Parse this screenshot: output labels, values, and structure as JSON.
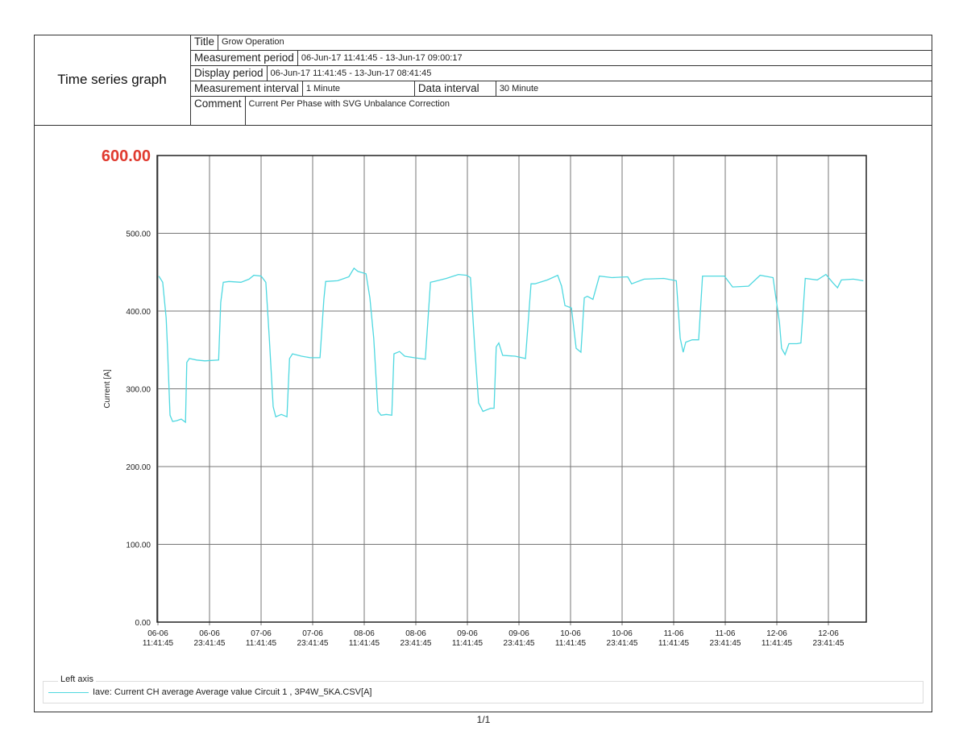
{
  "header": {
    "doc_title": "Time series graph",
    "title_label": "Title",
    "title_value": "Grow Operation",
    "measurement_period_label": "Measurement period",
    "measurement_period_value": "06-Jun-17 11:41:45 - 13-Jun-17 09:00:17",
    "display_period_label": "Display period",
    "display_period_value": "06-Jun-17 11:41:45 - 13-Jun-17 08:41:45",
    "measurement_interval_label": "Measurement interval",
    "measurement_interval_value": "1 Minute",
    "data_interval_label": "Data interval",
    "data_interval_value": "30 Minute",
    "comment_label": "Comment",
    "comment_value": "Current Per Phase with SVG Unbalance Correction"
  },
  "legend": {
    "title": "Left axis",
    "entry": "Iave: Current CH average Average value Circuit 1 , 3P4W_5KA.CSV[A]"
  },
  "page_number": "1/1",
  "colors": {
    "series": "#4fd8e0",
    "highlight": "#e03a2f",
    "grid": "#777777"
  },
  "chart_data": {
    "type": "line",
    "title": "",
    "xlabel": "",
    "ylabel": "Current [A]",
    "ylim": [
      0,
      600
    ],
    "xlim_hours": [
      0,
      165
    ],
    "grid": true,
    "legend_placement": "bottom",
    "y_ticks": [
      "0.00",
      "100.00",
      "200.00",
      "300.00",
      "400.00",
      "500.00",
      "600.00"
    ],
    "y_tick_values": [
      0,
      100,
      200,
      300,
      400,
      500,
      600
    ],
    "x_tick_hours": [
      0,
      12,
      24,
      36,
      48,
      60,
      72,
      84,
      96,
      108,
      120,
      132,
      144,
      156
    ],
    "x_ticks": [
      [
        "06-06",
        "11:41:45"
      ],
      [
        "06-06",
        "23:41:45"
      ],
      [
        "07-06",
        "11:41:45"
      ],
      [
        "07-06",
        "23:41:45"
      ],
      [
        "08-06",
        "11:41:45"
      ],
      [
        "08-06",
        "23:41:45"
      ],
      [
        "09-06",
        "11:41:45"
      ],
      [
        "09-06",
        "23:41:45"
      ],
      [
        "10-06",
        "11:41:45"
      ],
      [
        "10-06",
        "23:41:45"
      ],
      [
        "11-06",
        "11:41:45"
      ],
      [
        "11-06",
        "23:41:45"
      ],
      [
        "12-06",
        "11:41:45"
      ],
      [
        "12-06",
        "23:41:45"
      ]
    ],
    "series": [
      {
        "name": "Iave: Current CH average Average value Circuit 1 , 3P4W_5KA.CSV[A]",
        "x_hours": [
          0.4,
          1.3,
          2.1,
          2.4,
          3.0,
          3.6,
          4.5,
          5.6,
          6.6,
          6.9,
          7.5,
          9.2,
          11.1,
          14.3,
          14.8,
          15.4,
          16.7,
          19.5,
          21.4,
          22.5,
          24.2,
          25.3,
          26.1,
          27.0,
          27.6,
          28.9,
          30.2,
          30.8,
          31.5,
          33.6,
          35.6,
          37.9,
          38.8,
          39.2,
          42.0,
          44.6,
          45.8,
          46.7,
          48.6,
          49.5,
          50.4,
          51.4,
          52.1,
          53.3,
          54.6,
          55.1,
          56.4,
          57.6,
          59.8,
          62.4,
          63.6,
          64.5,
          67.3,
          70.1,
          72.0,
          72.9,
          73.9,
          74.8,
          75.8,
          77.6,
          78.4,
          78.9,
          79.5,
          80.4,
          83.3,
          85.7,
          87.0,
          87.9,
          90.8,
          93.2,
          94.1,
          94.9,
          96.4,
          97.5,
          98.6,
          99.4,
          100.1,
          101.4,
          102.9,
          105.8,
          109.5,
          110.4,
          113.3,
          117.9,
          120.8,
          121.7,
          122.4,
          123.0,
          124.5,
          126.0,
          126.9,
          132.0,
          133.9,
          137.6,
          140.3,
          143.3,
          144.8,
          145.3,
          146.1,
          147.0,
          148.9,
          149.8,
          150.8,
          153.6,
          155.6,
          157.3,
          158.3,
          159.2,
          162.0,
          164.3
        ],
        "values": [
          445,
          437,
          391,
          354,
          266,
          258,
          259,
          261,
          257,
          334,
          339,
          337,
          336,
          337,
          411,
          437,
          438,
          437,
          441,
          446,
          445,
          437,
          365,
          277,
          264,
          267,
          264,
          339,
          345,
          342,
          340,
          340,
          415,
          438,
          439,
          444,
          455,
          451,
          448,
          417,
          365,
          271,
          266,
          267,
          266,
          345,
          348,
          342,
          340,
          338,
          437,
          438,
          442,
          447,
          446,
          443,
          354,
          282,
          271,
          275,
          275,
          354,
          359,
          343,
          342,
          339,
          435,
          435,
          440,
          446,
          432,
          407,
          404,
          352,
          347,
          417,
          419,
          415,
          445,
          443,
          444,
          435,
          441,
          442,
          439,
          365,
          347,
          360,
          363,
          363,
          445,
          445,
          431,
          432,
          446,
          443,
          385,
          352,
          344,
          358,
          358,
          359,
          442,
          440,
          447,
          436,
          430,
          440,
          441,
          439
        ]
      }
    ]
  }
}
